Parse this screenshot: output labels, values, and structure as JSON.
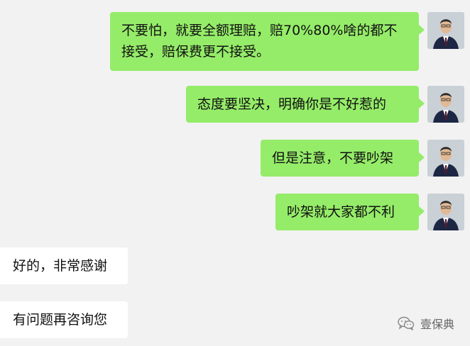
{
  "messages": [
    {
      "side": "outgoing",
      "text": "不要怕，就要全额理赔，赔70%80%啥的都不接受，赔保费更不接受。"
    },
    {
      "side": "outgoing",
      "text": "态度要坚决，明确你是不好惹的"
    },
    {
      "side": "outgoing",
      "text": "但是注意，不要吵架"
    },
    {
      "side": "outgoing",
      "text": "吵架就大家都不利"
    },
    {
      "side": "incoming",
      "text": "好的，非常感谢"
    },
    {
      "side": "incoming",
      "text": "有问题再咨询您"
    }
  ],
  "watermark": {
    "text": "壹保典",
    "icon": "wechat-icon"
  },
  "colors": {
    "background": "#f2f2f2",
    "outgoing_bubble": "#95ec69",
    "incoming_bubble": "#ffffff"
  }
}
